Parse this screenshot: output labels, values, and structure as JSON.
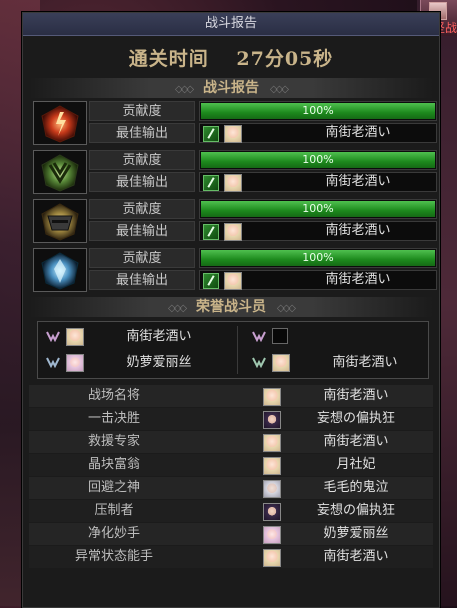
{
  "window": {
    "title": "战斗报告"
  },
  "corner_badge": {
    "label": "攻坚战"
  },
  "clear_time": {
    "label": "通关时间",
    "value": "27分05秒"
  },
  "battle_report": {
    "header": "战斗报告",
    "entries": [
      {
        "emblem": "red-dragon-emblem",
        "emblem_color": "#c83a1a",
        "contribution_label": "贡献度",
        "contribution": "100%",
        "contribution_fraction": 1.0,
        "best_output_label": "最佳输出",
        "best_player": "南街老酒い"
      },
      {
        "emblem": "green-beast-emblem",
        "emblem_color": "#5a8a3a",
        "contribution_label": "贡献度",
        "contribution": "100%",
        "contribution_fraction": 1.0,
        "best_output_label": "最佳输出",
        "best_player": "南街老酒い"
      },
      {
        "emblem": "gold-knight-emblem",
        "emblem_color": "#a08840",
        "contribution_label": "贡献度",
        "contribution": "100%",
        "contribution_fraction": 1.0,
        "best_output_label": "最佳输出",
        "best_player": "南街老酒い"
      },
      {
        "emblem": "blue-crystal-emblem",
        "emblem_color": "#4a90c0",
        "contribution_label": "贡献度",
        "contribution": "100%",
        "contribution_fraction": 1.0,
        "best_output_label": "最佳输出",
        "best_player": "南街老酒い"
      }
    ]
  },
  "honor_fighters": {
    "header": "荣誉战斗员",
    "slots": [
      {
        "name": "南街老酒い",
        "avatar": "blonde",
        "empty": false
      },
      {
        "name": "",
        "avatar": "none",
        "empty": true
      },
      {
        "name": "奶萝爱丽丝",
        "avatar": "pink",
        "empty": false
      },
      {
        "name": "南街老酒い",
        "avatar": "blonde",
        "empty": false
      }
    ]
  },
  "awards": [
    {
      "title": "战场名将",
      "player": "南街老酒い",
      "avatar": "blonde"
    },
    {
      "title": "一击决胜",
      "player": "妄想の偏执狂",
      "avatar": "dark"
    },
    {
      "title": "救援专家",
      "player": "南街老酒い",
      "avatar": "blonde"
    },
    {
      "title": "晶块富翁",
      "player": "月社妃",
      "avatar": "blonde"
    },
    {
      "title": "回避之神",
      "player": "毛毛的鬼泣",
      "avatar": "silver"
    },
    {
      "title": "压制者",
      "player": "妄想の偏执狂",
      "avatar": "dark"
    },
    {
      "title": "净化妙手",
      "player": "奶萝爱丽丝",
      "avatar": "pink"
    },
    {
      "title": "异常状态能手",
      "player": "南街老酒い",
      "avatar": "blonde"
    }
  ],
  "colors": {
    "bar_green": "#2aa02a",
    "gold_text": "#c9b48a",
    "title_bar": "#2a2e44"
  }
}
